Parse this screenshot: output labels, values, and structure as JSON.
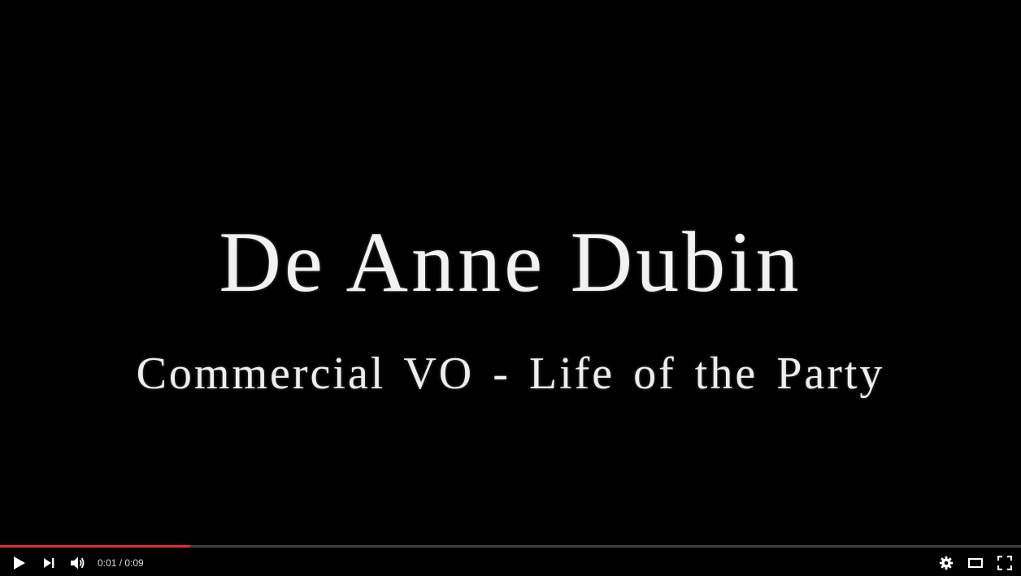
{
  "video": {
    "title_line": "De Anne Dubin",
    "subtitle_line": "Commercial VO - Life of the Party"
  },
  "progress": {
    "played_fraction": 0.186,
    "loaded_fraction": 0.186,
    "played_color": "#e52d27"
  },
  "controls": {
    "current_time": "0:01",
    "separator": " / ",
    "duration": "0:09",
    "play_icon": "play-icon",
    "next_icon": "next-icon",
    "volume_icon": "volume-icon",
    "settings_icon": "gear-icon",
    "theater_icon": "theater-mode-icon",
    "fullscreen_icon": "fullscreen-icon"
  }
}
